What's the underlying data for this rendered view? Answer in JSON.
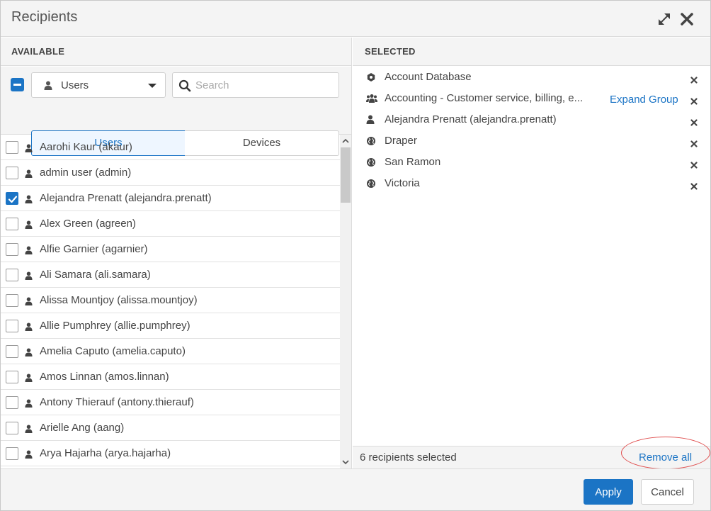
{
  "dialog": {
    "title": "Recipients"
  },
  "available": {
    "header": "AVAILABLE",
    "type_select": {
      "value": "Users"
    },
    "search": {
      "placeholder": "Search",
      "value": ""
    },
    "tabs": [
      {
        "label": "Users",
        "active": true
      },
      {
        "label": "Devices",
        "active": false
      }
    ],
    "items": [
      {
        "label": "Aarohi Kaur (akaur)",
        "checked": false
      },
      {
        "label": "admin user (admin)",
        "checked": false
      },
      {
        "label": "Alejandra Prenatt (alejandra.prenatt)",
        "checked": true
      },
      {
        "label": "Alex Green (agreen)",
        "checked": false
      },
      {
        "label": "Alfie Garnier (agarnier)",
        "checked": false
      },
      {
        "label": "Ali Samara (ali.samara)",
        "checked": false
      },
      {
        "label": "Alissa Mountjoy (alissa.mountjoy)",
        "checked": false
      },
      {
        "label": "Allie Pumphrey (allie.pumphrey)",
        "checked": false
      },
      {
        "label": "Amelia Caputo (amelia.caputo)",
        "checked": false
      },
      {
        "label": "Amos Linnan (amos.linnan)",
        "checked": false
      },
      {
        "label": "Antony Thierauf (antony.thierauf)",
        "checked": false
      },
      {
        "label": "Arielle Ang (aang)",
        "checked": false
      },
      {
        "label": "Arya Hajarha (arya.hajarha)",
        "checked": false
      }
    ]
  },
  "selected": {
    "header": "SELECTED",
    "items": [
      {
        "label": "Account Database",
        "icon": "hexagon-icon"
      },
      {
        "label": "Accounting - Customer service, billing, e...",
        "icon": "group-icon",
        "action": "Expand Group"
      },
      {
        "label": "Alejandra Prenatt (alejandra.prenatt)",
        "icon": "user-icon"
      },
      {
        "label": "Draper",
        "icon": "globe-icon"
      },
      {
        "label": "San Ramon",
        "icon": "globe-icon"
      },
      {
        "label": "Victoria",
        "icon": "globe-icon"
      }
    ],
    "count_text": "6 recipients selected",
    "remove_all": "Remove all"
  },
  "actions": {
    "apply": "Apply",
    "cancel": "Cancel"
  },
  "colors": {
    "accent": "#1b74c5",
    "highlight_ring": "#e05050"
  }
}
